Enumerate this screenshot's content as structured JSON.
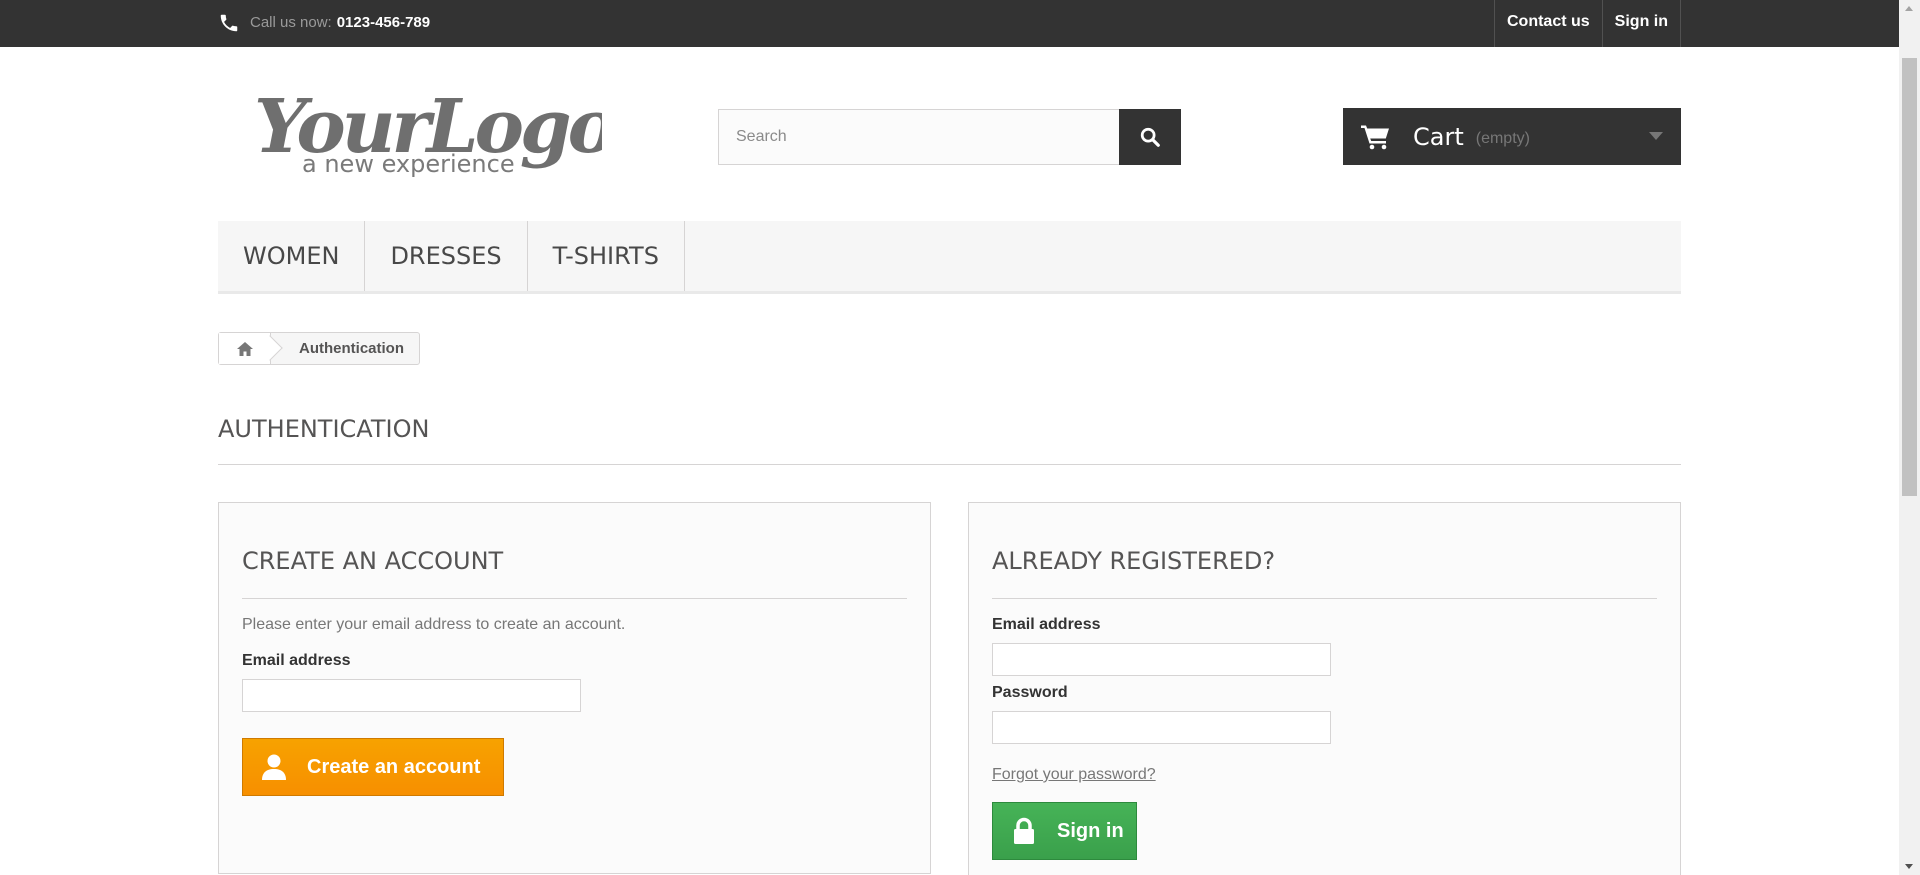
{
  "topbar": {
    "call_label": "Call us now:",
    "phone": "0123-456-789",
    "links": [
      "Contact us",
      "Sign in"
    ]
  },
  "logo": {
    "main": "YourLogo",
    "tagline": "a new experience"
  },
  "search": {
    "placeholder": "Search"
  },
  "cart": {
    "label": "Cart",
    "status": "(empty)"
  },
  "menu": {
    "items": [
      "WOMEN",
      "DRESSES",
      "T-SHIRTS"
    ]
  },
  "breadcrumb": {
    "current": "Authentication"
  },
  "page_heading": "AUTHENTICATION",
  "create_account": {
    "title": "CREATE AN ACCOUNT",
    "help": "Please enter your email address to create an account.",
    "email_label": "Email address",
    "button": "Create an account"
  },
  "login": {
    "title": "ALREADY REGISTERED?",
    "email_label": "Email address",
    "password_label": "Password",
    "forgot": "Forgot your password?",
    "button": "Sign in"
  },
  "colors": {
    "dark_bar": "#333333",
    "create_button": "#f7a200",
    "signin_button": "#46b357"
  }
}
